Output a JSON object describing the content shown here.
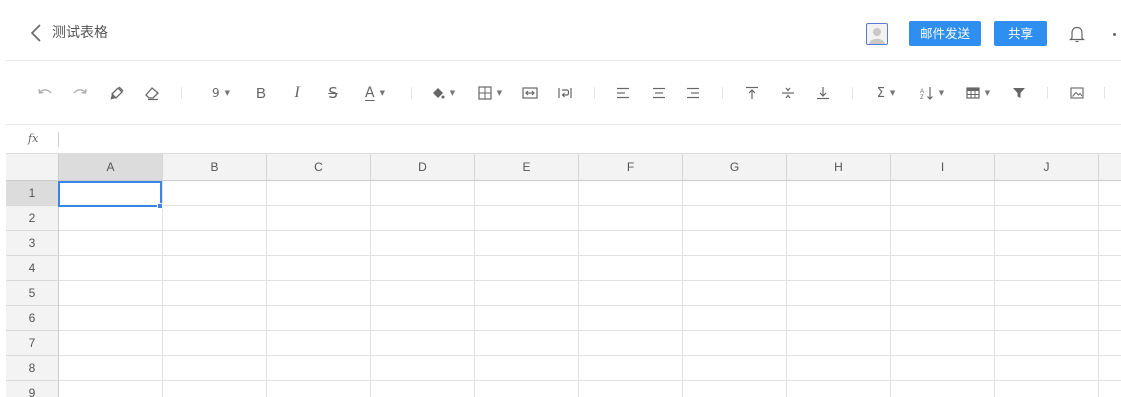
{
  "header": {
    "title": "测试表格",
    "mail_button": "邮件发送",
    "share_button": "共享"
  },
  "toolbar": {
    "font_size": "9",
    "bold_label": "B",
    "italic_label": "I",
    "strike_label": "S",
    "font_color_label": "A",
    "sum_label": "Σ"
  },
  "formula_bar": {
    "fx_label": "fx",
    "value": ""
  },
  "sheet": {
    "columns": [
      "A",
      "B",
      "C",
      "D",
      "E",
      "F",
      "G",
      "H",
      "I",
      "J"
    ],
    "rows": [
      "1",
      "2",
      "3",
      "4",
      "5",
      "6",
      "7",
      "8",
      "9"
    ],
    "active_cell": "A1"
  },
  "colors": {
    "accent": "#2f8ff0",
    "selection": "#3a84e8"
  }
}
